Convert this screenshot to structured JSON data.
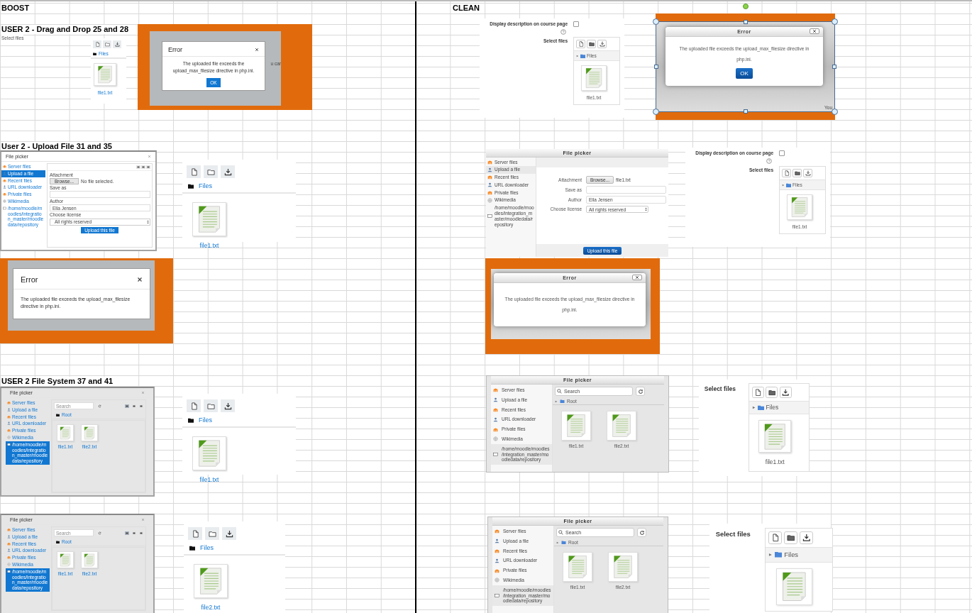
{
  "columns": [
    {
      "heading": "BOOST",
      "cells": [
        {
          "kind": "heading",
          "text": "USER 2 - Drag and Drop 25 and 28"
        },
        {
          "kind": "note",
          "text": "Select files"
        },
        {
          "kind": "heading",
          "text": "User 2 - Upload File 31 and 35"
        },
        {
          "kind": "heading",
          "text": "USER 2 File System 37 and 41"
        }
      ],
      "snippets": [
        {
          "kind": "file_manager",
          "selected": false,
          "folder": "Files",
          "files": [
            {
              "kind": "text",
              "name": "file1.txt"
            }
          ]
        },
        {
          "kind": "error_dialog",
          "selected": false,
          "title": "Error",
          "message": "The uploaded file exceeds the upload_max_filesize directive in php.ini.",
          "button": "OK",
          "behind_text": "u car"
        },
        {
          "kind": "file_picker_upload",
          "selected": false,
          "title": "File picker",
          "sources": [
            {
              "label": "Server files",
              "selected": false
            },
            {
              "label": "Upload a file",
              "selected": true
            },
            {
              "label": "Recent files",
              "selected": false
            },
            {
              "label": "URL downloader",
              "selected": false
            },
            {
              "label": "Private files",
              "selected": false
            },
            {
              "label": "Wikimedia",
              "selected": false
            },
            {
              "label": "/home/moodle/moodles/integration_master/moodledata/repository",
              "selected": false
            }
          ],
          "views": [
            {
              "selected": false
            },
            {
              "selected": false
            },
            {
              "selected": false
            }
          ],
          "form": {
            "attachment_label": "Attachment",
            "browse_button": "Browse...",
            "file_status": "No file selected.",
            "save_as_label": "Save as",
            "author_label": "Author",
            "author": "Ella Jensen",
            "license_label": "Choose license",
            "license": "All rights reserved",
            "upload_button": "Upload this file"
          }
        },
        {
          "kind": "file_manager",
          "selected": false,
          "folder": "Files",
          "files": [
            {
              "kind": "text",
              "name": "file1.txt"
            }
          ]
        },
        {
          "kind": "error_dialog",
          "selected": false,
          "title": "Error",
          "message": "The uploaded file exceeds the upload_max_filesize directive in php.ini."
        },
        {
          "kind": "file_picker_browse",
          "selected": false,
          "title": "File picker",
          "sources": [
            {
              "label": "Server files",
              "selected": false
            },
            {
              "label": "Upload a file",
              "selected": false
            },
            {
              "label": "Recent files",
              "selected": false
            },
            {
              "label": "URL downloader",
              "selected": false
            },
            {
              "label": "Private files",
              "selected": false
            },
            {
              "label": "Wikimedia",
              "selected": false
            },
            {
              "label": "/home/moodle/moodles/integration_master/moodledata/repository",
              "selected": true
            }
          ],
          "views": [
            {
              "selected": true
            },
            {
              "selected": false
            },
            {
              "selected": false
            }
          ],
          "search_placeholder": "Search",
          "path": "Root",
          "files": [
            {
              "kind": "text",
              "name": "file1.txt"
            },
            {
              "kind": "text",
              "name": "file2.txt"
            }
          ]
        },
        {
          "kind": "file_manager",
          "selected": false,
          "folder": "Files",
          "files": [
            {
              "kind": "text",
              "name": "file1.txt"
            }
          ]
        },
        {
          "kind": "file_picker_browse",
          "selected": false,
          "title": "File picker",
          "sources": [
            {
              "label": "Server files",
              "selected": false
            },
            {
              "label": "Upload a file",
              "selected": false
            },
            {
              "label": "Recent files",
              "selected": false
            },
            {
              "label": "URL downloader",
              "selected": false
            },
            {
              "label": "Private files",
              "selected": false
            },
            {
              "label": "Wikimedia",
              "selected": false
            },
            {
              "label": "/home/moodle/moodles/integration_master/moodledata/repository",
              "selected": true
            }
          ],
          "views": [
            {
              "selected": true
            },
            {
              "selected": false
            },
            {
              "selected": false
            }
          ],
          "search_placeholder": "Search",
          "path": "Root",
          "files": [
            {
              "kind": "text",
              "name": "file1.txt"
            },
            {
              "kind": "text",
              "name": "file2.txt"
            }
          ]
        },
        {
          "kind": "file_manager",
          "selected": false,
          "folder": "Files",
          "files": [
            {
              "kind": "text",
              "name": "file2.txt"
            }
          ]
        }
      ]
    },
    {
      "heading": "CLEAN",
      "snippets": [
        {
          "kind": "file_manager",
          "selected": false,
          "option": {
            "label": "Display description on course page",
            "checked": false
          },
          "label": "Select files",
          "folder": "Files",
          "files": [
            {
              "kind": "text",
              "name": "file1.txt"
            }
          ]
        },
        {
          "kind": "error_dialog",
          "selected": true,
          "title": "Error",
          "message": "The uploaded file exceeds the upload_max_filesize directive in php.ini.",
          "button": "OK",
          "behind_text": "You"
        },
        {
          "kind": "file_picker_upload",
          "selected": false,
          "title": "File picker",
          "sources": [
            {
              "label": "Server files",
              "selected": false
            },
            {
              "label": "Upload a file",
              "selected": true
            },
            {
              "label": "Recent files",
              "selected": false
            },
            {
              "label": "URL downloader",
              "selected": false
            },
            {
              "label": "Private files",
              "selected": false
            },
            {
              "label": "Wikimedia",
              "selected": false
            },
            {
              "label": "/home/moodle/moodles/integration_master/moodledata/repository",
              "selected": false
            }
          ],
          "form": {
            "attachment_label": "Attachment",
            "browse_button": "Browse...",
            "file_status": "file1.txt",
            "save_as_label": "Save as",
            "author_label": "Author",
            "author": "Ella Jensen",
            "license_label": "Choose license",
            "license": "All rights reserved",
            "upload_button": "Upload this file"
          }
        },
        {
          "kind": "file_manager",
          "selected": false,
          "option": {
            "label": "Display description on course page",
            "checked": false
          },
          "label": "Select files",
          "folder": "Files",
          "files": [
            {
              "kind": "text",
              "name": "file1.txt"
            }
          ]
        },
        {
          "kind": "error_dialog",
          "selected": false,
          "title": "Error",
          "message": "The uploaded file exceeds the upload_max_filesize directive in php.ini."
        },
        {
          "kind": "file_picker_browse",
          "selected": false,
          "title": "File picker",
          "sources": [
            {
              "label": "Server files",
              "selected": false
            },
            {
              "label": "Upload a file",
              "selected": false
            },
            {
              "label": "Recent files",
              "selected": false
            },
            {
              "label": "URL downloader",
              "selected": false
            },
            {
              "label": "Private files",
              "selected": false
            },
            {
              "label": "Wikimedia",
              "selected": false
            },
            {
              "label": "/home/moodle/moodles/integration_master/moodledata/repository",
              "selected": true
            }
          ],
          "search_placeholder": "Search",
          "path": "Root",
          "files": [
            {
              "kind": "text",
              "name": "file1.txt"
            },
            {
              "kind": "text",
              "name": "file2.txt"
            }
          ]
        },
        {
          "kind": "file_manager",
          "selected": false,
          "label": "Select files",
          "folder": "Files",
          "files": [
            {
              "kind": "text",
              "name": "file1.txt"
            }
          ]
        },
        {
          "kind": "file_picker_browse",
          "selected": false,
          "title": "File picker",
          "sources": [
            {
              "label": "Server files",
              "selected": false
            },
            {
              "label": "Upload a file",
              "selected": false
            },
            {
              "label": "Recent files",
              "selected": false
            },
            {
              "label": "URL downloader",
              "selected": false
            },
            {
              "label": "Private files",
              "selected": false
            },
            {
              "label": "Wikimedia",
              "selected": false
            },
            {
              "label": "/home/moodle/moodles/integration_master/moodledata/repository",
              "selected": true
            }
          ],
          "search_placeholder": "Search",
          "path": "Root",
          "files": [
            {
              "kind": "text",
              "name": "file1.txt"
            },
            {
              "kind": "text",
              "name": "file2.txt"
            }
          ]
        },
        {
          "kind": "file_manager",
          "selected": false,
          "label": "Select files",
          "folder": "Files",
          "files": [
            {
              "kind": "text"
            }
          ]
        }
      ]
    }
  ]
}
